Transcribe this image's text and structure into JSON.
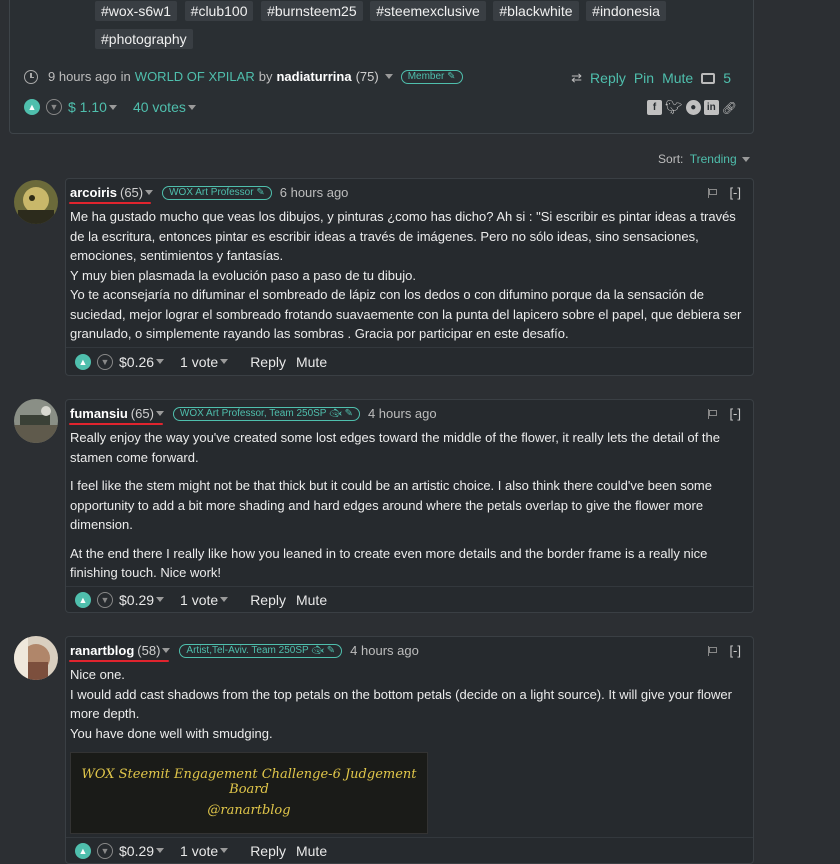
{
  "post": {
    "tags": [
      "#wox-s6w1",
      "#club100",
      "#burnsteem25",
      "#steemexclusive",
      "#blackwhite",
      "#indonesia",
      "#photography"
    ],
    "time_ago": "9 hours ago",
    "in_text": "in",
    "community": "WORLD OF XPILAR",
    "by_text": "by",
    "author": "nadiaturrina",
    "reputation": "(75)",
    "badge": "Member",
    "reply_label": "Reply",
    "pin_label": "Pin",
    "mute_label": "Mute",
    "comment_count": "5",
    "payout": "$ 1.10",
    "votes": "40 votes",
    "share_icons": [
      "facebook-icon",
      "twitter-icon",
      "reddit-icon",
      "linkedin-icon",
      "link-icon"
    ]
  },
  "sort": {
    "label": "Sort:",
    "value": "Trending"
  },
  "comments": [
    {
      "author": "arcoiris",
      "reputation": "(65)",
      "badge": "WOX Art Professor",
      "time_ago": "6 hours ago",
      "collapse": "[-]",
      "body": [
        "Me ha gustado mucho que veas los dibujos, y pinturas ¿como has dicho? Ah si : \"Si escribir es pintar ideas a través de la escritura, entonces pintar es escribir ideas a través de imágenes. Pero no sólo ideas, sino sensaciones, emociones, sentimientos y fantasías.",
        "Y muy bien plasmada la evolución paso a paso de tu dibujo.",
        "Yo te aconsejaría no difuminar el sombreado de lápiz con los dedos o con difumino porque da la sensación de suciedad, mejor lograr el sombreado frotando suavaemente con la punta del lapicero sobre el papel, que debiera ser granulado, o simplemente rayando las sombras . Gracia por participar en este desafío."
      ],
      "payout": "$0.26",
      "votes": "1 vote",
      "reply_label": "Reply",
      "mute_label": "Mute"
    },
    {
      "author": "fumansiu",
      "reputation": "(65)",
      "badge": "WOX Art Professor, Team 250SP",
      "time_ago": "4 hours ago",
      "collapse": "[-]",
      "body": [
        "Really enjoy the way you've created some lost edges toward the middle of the flower, it really lets the detail of the stamen come forward.",
        "I feel like the stem might not be that thick but it could be an artistic choice. I also think there could've been some opportunity to add a bit more shading and hard edges around where the petals overlap to give the flower more dimension.",
        "At the end there I really like how you leaned in to create even more details and the border frame is a really nice finishing touch. Nice work!"
      ],
      "payout": "$0.29",
      "votes": "1 vote",
      "reply_label": "Reply",
      "mute_label": "Mute"
    },
    {
      "author": "ranartblog",
      "reputation": "(58)",
      "badge": "Artist,Tel-Aviv. Team 250SP",
      "time_ago": "4 hours ago",
      "collapse": "[-]",
      "body": [
        "Nice one.",
        "I would add cast shadows from the top petals on the bottom petals (decide on a light source). It will give your flower more depth.",
        "You have done well with smudging."
      ],
      "banner_line1": "WOX Steemit Engagement Challenge-6 Judgement Board",
      "banner_line2": "@ranartblog",
      "payout": "$0.29",
      "votes": "1 vote",
      "reply_label": "Reply",
      "mute_label": "Mute"
    }
  ],
  "colors": {
    "accent": "#4fbfad",
    "background": "#2c2f33",
    "underline": "#e0242e"
  }
}
